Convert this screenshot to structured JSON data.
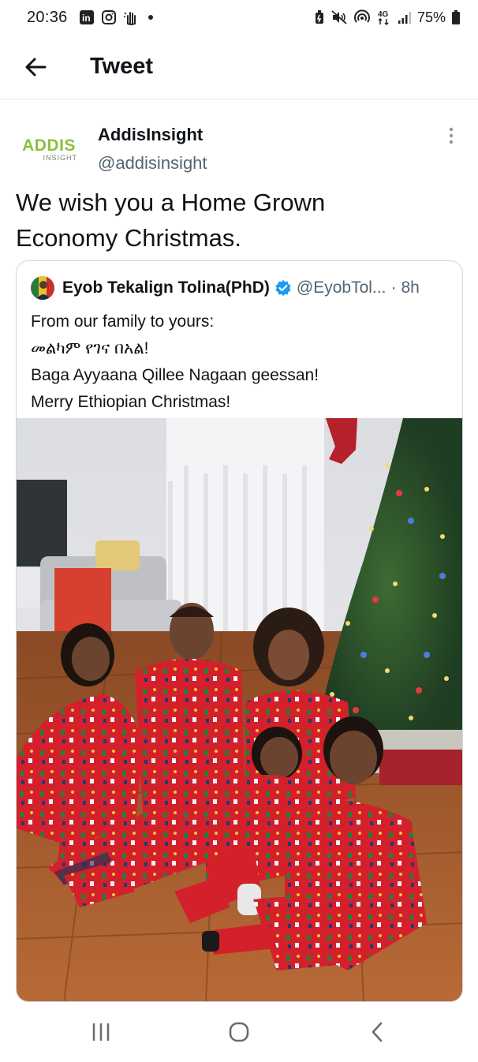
{
  "status_bar": {
    "time": "20:36",
    "network": "4G",
    "battery": "75%",
    "icons_left": [
      "linkedin-icon",
      "instagram-icon",
      "hand-icon",
      "dot-icon"
    ],
    "icons_right": [
      "battery-saver-icon",
      "mute-icon",
      "hotspot-icon",
      "network-icon",
      "signal-icon",
      "battery-icon"
    ]
  },
  "header": {
    "title": "Tweet",
    "back_icon": "arrow-left-icon"
  },
  "tweet": {
    "author": {
      "name": "AddisInsight",
      "handle": "@addisinsight",
      "avatar_logo": "ADDIS",
      "avatar_logo_sub": "INSIGHT"
    },
    "text": "We wish you a Home Grown\nEconomy Christmas.",
    "more_icon": "more-vertical-icon"
  },
  "quoted_tweet": {
    "author_name": "Eyob Tekalign Tolina(PhD)",
    "handle": "@EyobTol...",
    "separator": "·",
    "time": "8h",
    "verified_color": "#1d9bf0",
    "lines": [
      "From our family to yours:",
      "መልካም የገና በአል!",
      "Baga Ayyaana Qillee Nagaan geessan!",
      "Merry Ethiopian Christmas!"
    ]
  },
  "nav_bar": {
    "icons": [
      "recent-apps-icon",
      "home-icon",
      "back-icon"
    ]
  },
  "colors": {
    "text_primary": "#0f1419",
    "text_secondary": "#536471",
    "border": "#cfd9de",
    "brand_green": "#8cbf3f"
  }
}
